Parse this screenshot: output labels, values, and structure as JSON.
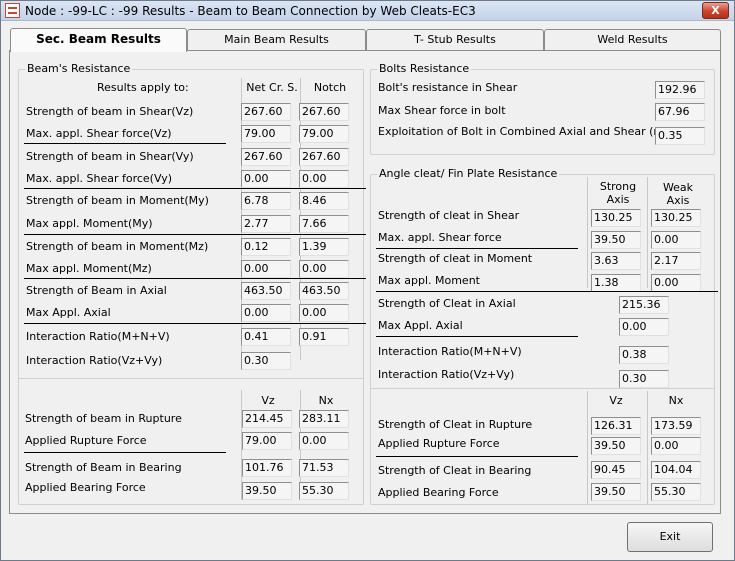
{
  "window": {
    "title": "Node : -99-LC : -99 Results - Beam to Beam Connection by Web Cleats-EC3",
    "close_label": "X"
  },
  "tabs": [
    "Sec. Beam Results",
    "Main Beam Results",
    "T- Stub Results",
    "Weld Results"
  ],
  "beam": {
    "group_title": "Beam's Resistance",
    "results_apply": "Results apply to:",
    "col_headers": [
      "Net Cr. S.",
      "Notch"
    ],
    "rows": [
      {
        "label": "Strength of beam in Shear(Vz)",
        "values": [
          "267.60",
          "267.60"
        ]
      },
      {
        "label": "Max. appl. Shear force(Vz)",
        "values": [
          "79.00",
          "79.00"
        ]
      },
      {
        "label": "Strength of beam in Shear(Vy)",
        "values": [
          "267.60",
          "267.60"
        ]
      },
      {
        "label": "Max. appl. Shear force(Vy)",
        "values": [
          "0.00",
          "0.00"
        ]
      },
      {
        "label": "Strength of beam in Moment(My)",
        "values": [
          "6.78",
          "8.46"
        ]
      },
      {
        "label": "Max appl. Moment(My)",
        "values": [
          "2.77",
          "7.66"
        ]
      },
      {
        "label": "Strength of beam in Moment(Mz)",
        "values": [
          "0.12",
          "1.39"
        ]
      },
      {
        "label": "Max appl. Moment(Mz)",
        "values": [
          "0.00",
          "0.00"
        ]
      },
      {
        "label": "Strength of Beam in Axial",
        "values": [
          "463.50",
          "463.50"
        ]
      },
      {
        "label": "Max Appl. Axial",
        "values": [
          "0.00",
          "0.00"
        ]
      },
      {
        "label": "Interaction Ratio(M+N+V)",
        "values": [
          "0.41",
          "0.91"
        ]
      },
      {
        "label": "Interaction Ratio(Vz+Vy)",
        "values": [
          "0.30"
        ]
      }
    ],
    "bottom_headers": [
      "Vz",
      "Nx"
    ],
    "bottom_rows": [
      {
        "label": "Strength of beam in Rupture",
        "values": [
          "214.45",
          "283.11"
        ]
      },
      {
        "label": "Applied Rupture Force",
        "values": [
          "79.00",
          "0.00"
        ]
      },
      {
        "label": "Strength of Beam in Bearing",
        "values": [
          "101.76",
          "71.53"
        ]
      },
      {
        "label": "Applied Bearing Force",
        "values": [
          "39.50",
          "55.30"
        ]
      }
    ]
  },
  "bolts": {
    "group_title": "Bolts Resistance",
    "rows": [
      {
        "label": "Bolt's resistance in Shear",
        "value": "192.96"
      },
      {
        "label": "Max Shear force in bolt",
        "value": "67.96"
      },
      {
        "label": "Exploitation of Bolt in Combined Axial and Shear (ratio)",
        "value": "0.35"
      }
    ]
  },
  "cleat": {
    "group_title": "Angle cleat/ Fin Plate Resistance",
    "col_headers": [
      [
        "Strong",
        "Axis"
      ],
      [
        "Weak",
        "Axis"
      ]
    ],
    "rows": [
      {
        "label": "Strength of cleat in Shear",
        "values": [
          "130.25",
          "130.25"
        ]
      },
      {
        "label": "Max. appl. Shear force",
        "values": [
          "39.50",
          "0.00"
        ]
      },
      {
        "label": "Strength of cleat in Moment",
        "values": [
          "3.63",
          "2.17"
        ]
      },
      {
        "label": "Max appl. Moment",
        "values": [
          "1.38",
          "0.00"
        ]
      }
    ],
    "single_rows": [
      {
        "label": "Strength of Cleat in Axial",
        "value": "215.36"
      },
      {
        "label": "Max Appl. Axial",
        "value": "0.00"
      },
      {
        "label": "Interaction Ratio(M+N+V)",
        "value": "0.38"
      },
      {
        "label": "Interaction Ratio(Vz+Vy)",
        "value": "0.30"
      }
    ],
    "bottom_headers": [
      "Vz",
      "Nx"
    ],
    "bottom_rows": [
      {
        "label": "Strength of Cleat in Rupture",
        "values": [
          "126.31",
          "173.59"
        ]
      },
      {
        "label": "Applied Rupture Force",
        "values": [
          "39.50",
          "0.00"
        ]
      },
      {
        "label": "Strength of Cleat in Bearing",
        "values": [
          "90.45",
          "104.04"
        ]
      },
      {
        "label": "Applied Bearing Force",
        "values": [
          "39.50",
          "55.30"
        ]
      }
    ]
  },
  "exit_label": "Exit"
}
